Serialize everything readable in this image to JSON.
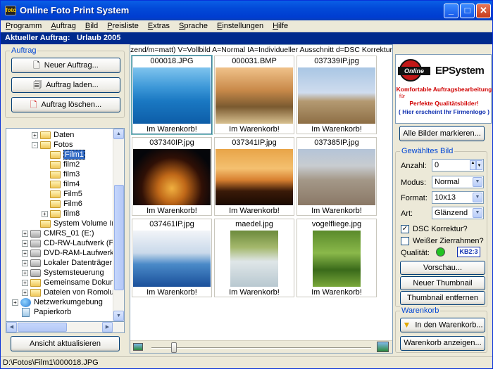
{
  "window": {
    "title": "Online Foto Print System",
    "icon_label": "foto"
  },
  "menu": [
    "Programm",
    "Auftrag",
    "Bild",
    "Preisliste",
    "Extras",
    "Sprache",
    "Einstellungen",
    "Hilfe"
  ],
  "menu_underline": [
    "P",
    "A",
    "B",
    "P",
    "E",
    "S",
    "E",
    "H"
  ],
  "order_bar": {
    "label": "Aktueller Auftrag:",
    "value": "Urlaub 2005"
  },
  "auftrag_group": {
    "label": "Auftrag",
    "buttons": [
      "Neuer Auftrag...",
      "Auftrag laden...",
      "Auftrag löschen..."
    ]
  },
  "tree": [
    {
      "label": "Daten",
      "level": 2,
      "expander": "+",
      "icon": "folder"
    },
    {
      "label": "Fotos",
      "level": 2,
      "expander": "-",
      "icon": "folder"
    },
    {
      "label": "Film1",
      "level": 3,
      "expander": "",
      "icon": "folder",
      "selected": true
    },
    {
      "label": "film2",
      "level": 3,
      "expander": "",
      "icon": "folder"
    },
    {
      "label": "film3",
      "level": 3,
      "expander": "",
      "icon": "folder"
    },
    {
      "label": "film4",
      "level": 3,
      "expander": "",
      "icon": "folder"
    },
    {
      "label": "Film5",
      "level": 3,
      "expander": "",
      "icon": "folder"
    },
    {
      "label": "Film6",
      "level": 3,
      "expander": "",
      "icon": "folder"
    },
    {
      "label": "film8",
      "level": 3,
      "expander": "+",
      "icon": "folder"
    },
    {
      "label": "System Volume Infor",
      "level": 2,
      "expander": "",
      "icon": "folder"
    },
    {
      "label": "CMRS_01 (E:)",
      "level": 1,
      "expander": "+",
      "icon": "drive"
    },
    {
      "label": "CD-RW-Laufwerk (F:)",
      "level": 1,
      "expander": "+",
      "icon": "drive"
    },
    {
      "label": "DVD-RAM-Laufwerk (G:)",
      "level": 1,
      "expander": "+",
      "icon": "drive"
    },
    {
      "label": "Lokaler Datenträger (H:)",
      "level": 1,
      "expander": "+",
      "icon": "drive"
    },
    {
      "label": "Systemsteuerung",
      "level": 1,
      "expander": "+",
      "icon": "drive"
    },
    {
      "label": "Gemeinsame Dokumente",
      "level": 1,
      "expander": "+",
      "icon": "folder"
    },
    {
      "label": "Dateien von Romolus",
      "level": 1,
      "expander": "+",
      "icon": "folder"
    },
    {
      "label": "Netzwerkumgebung",
      "level": 0,
      "expander": "+",
      "icon": "network"
    },
    {
      "label": "Papierkorb",
      "level": 0,
      "expander": "",
      "icon": "bin"
    }
  ],
  "refresh_button": "Ansicht aktualisieren",
  "legend_text": "zend/m=matt) V=Vollbild  A=Normal IA=Individueller Ausschnitt  d=DSC Korrektur  ||=Z",
  "thumbnails": [
    {
      "file": "000018.JPG",
      "status": "Im Warenkorb!",
      "scene": "pool"
    },
    {
      "file": "000031.BMP",
      "status": "Im Warenkorb!",
      "scene": "child"
    },
    {
      "file": "037339IP.jpg",
      "status": "Im Warenkorb!",
      "scene": "pyramids-day"
    },
    {
      "file": "037340IP.jpg",
      "status": "Im Warenkorb!",
      "scene": "pyramid-night"
    },
    {
      "file": "037341IP.jpg",
      "status": "Im Warenkorb!",
      "scene": "pyramids-sunset"
    },
    {
      "file": "037385IP.jpg",
      "status": "Im Warenkorb!",
      "scene": "city"
    },
    {
      "file": "037461IP.jpg",
      "status": "Im Warenkorb!",
      "scene": "sea"
    },
    {
      "file": "maedel.jpg",
      "status": "Im Warenkorb!",
      "scene": "girl"
    },
    {
      "file": "vogelfliege.jpg",
      "status": "Im Warenkorb!",
      "scene": "grass"
    }
  ],
  "logo": {
    "circle_text": "Online",
    "eps_text": "EPSystem",
    "tagline1": "Komfortable Auftragsbearbeitung",
    "tagline2_prefix": "für",
    "tagline2": "Perfekte Qualitätsbilder!",
    "tagline3": "( Hier erscheint Ihr Firmenlogo )"
  },
  "mark_all_button": "Alle Bilder markieren...",
  "selected_image": {
    "label": "Gewähltes Bild",
    "anzahl_label": "Anzahl:",
    "anzahl_value": "0",
    "modus_label": "Modus:",
    "modus_value": "Normal",
    "format_label": "Format:",
    "format_value": "10x13",
    "art_label": "Art:",
    "art_value": "Glänzend",
    "dsc_label": "DSC Korrektur?",
    "dsc_checked": true,
    "border_label": "Weißer Zierrahmen?",
    "border_checked": false,
    "quality_label": "Qualität:",
    "quality_color": "#22c322",
    "quality_badge": "KB2:3",
    "buttons": [
      "Vorschau...",
      "Neuer Thumbnail",
      "Thumbnail entfernen"
    ]
  },
  "basket": {
    "label": "Warenkorb",
    "add_button": "In den Warenkorb...",
    "show_button": "Warenkorb anzeigen..."
  },
  "status": "D:\\Fotos\\Film1\\000018.JPG"
}
